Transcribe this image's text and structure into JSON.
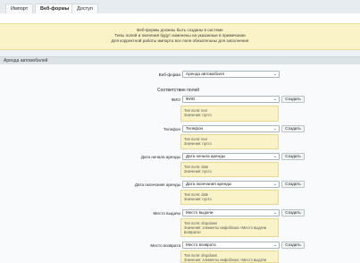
{
  "tabs": [
    {
      "label": "Импорт"
    },
    {
      "label": "Веб-формы"
    },
    {
      "label": "Доступ"
    }
  ],
  "notice": {
    "lines": [
      "Веб-формы должны быть созданы в системе",
      "Типы полей и значения будут изменены на указанные в примечании",
      "Для корректной работы импорта все поля обязательны для заполнения"
    ]
  },
  "section": {
    "title": "Аренда автомобилей"
  },
  "webform": {
    "label": "Веб-форма",
    "value": "Аренда автомобиля"
  },
  "mapping_title": "Соответствие полей",
  "fields": [
    {
      "label": "ФИО",
      "value": "ФИО",
      "button": "Создать",
      "info": [
        "Тип поля: text",
        "Значения: пусто"
      ]
    },
    {
      "label": "Телефон",
      "value": "Телефон",
      "button": "Создать",
      "info": [
        "Тип поля: text",
        "Значения: пусто"
      ]
    },
    {
      "label": "Дата начала аренды",
      "value": "Дата начала аренды",
      "button": "Создать",
      "info": [
        "Тип поля: date",
        "Значения: пусто"
      ]
    },
    {
      "label": "Дата окончания аренды",
      "value": "Дата окончания аренды",
      "button": "Создать",
      "info": [
        "Тип поля: date",
        "Значения: пусто"
      ]
    },
    {
      "label": "Место выдачи",
      "value": "Место выдачи",
      "button": "Создать",
      "info": [
        "Тип поля: dropdown",
        "Значения: элементы инфоблока «Место выдачи",
        "возврата»"
      ]
    },
    {
      "label": "Место возврата",
      "value": "Место возврата",
      "button": "Создать",
      "info": [
        "Тип поля: dropdown",
        "Значения: элементы инфоблока «Место выдачи"
      ]
    }
  ]
}
